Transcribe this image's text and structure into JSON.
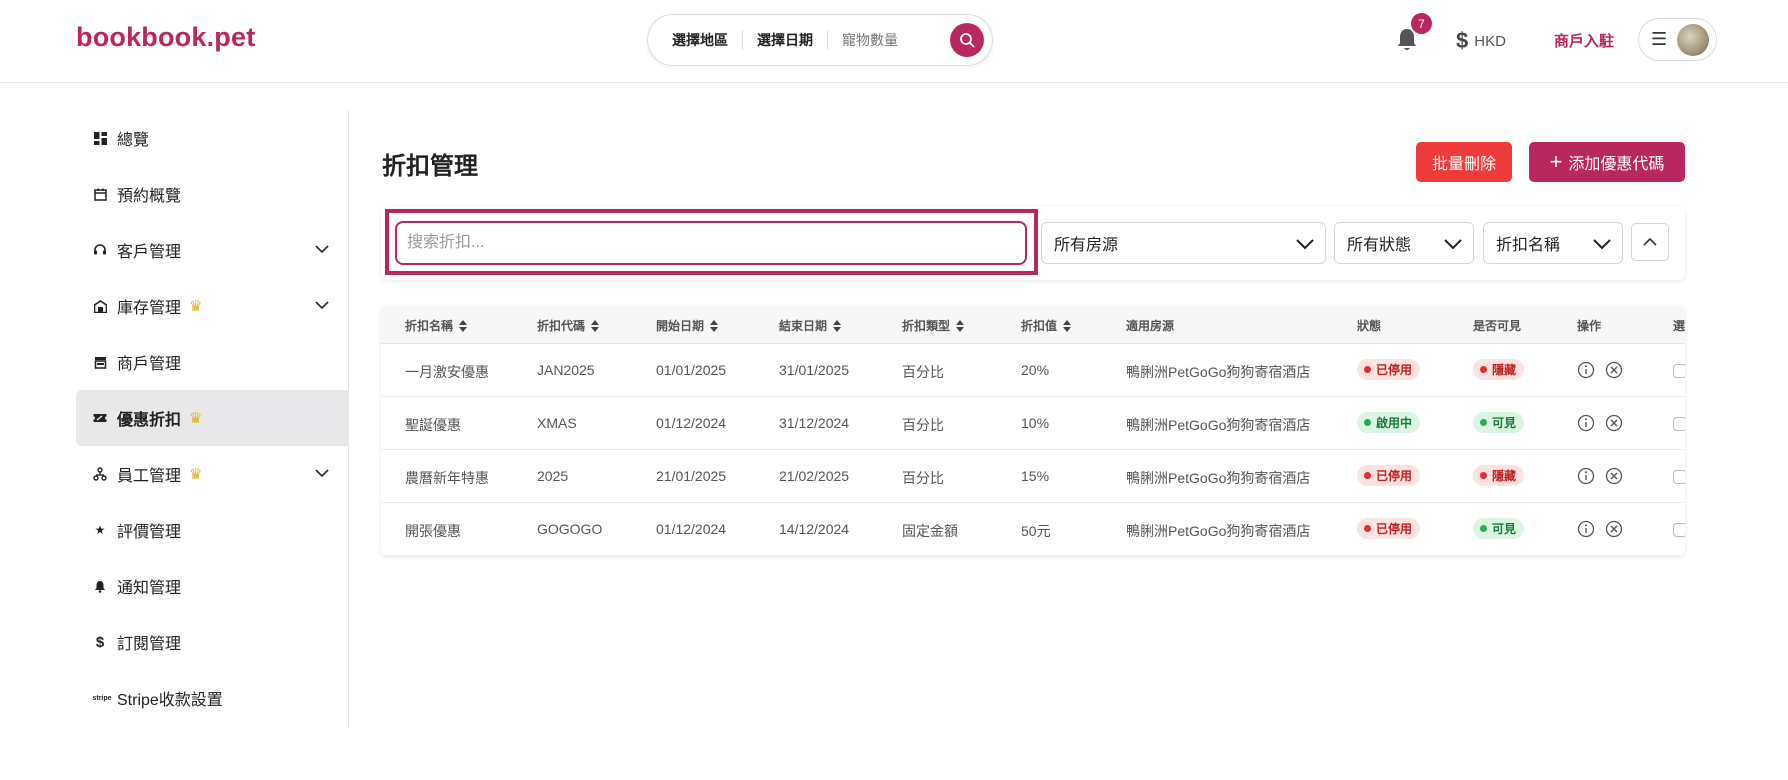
{
  "header": {
    "logo": "bookbook.pet",
    "search": {
      "region": "選擇地區",
      "date": "選擇日期",
      "pets": "寵物數量"
    },
    "notifications_count": "7",
    "currency": "HKD",
    "merchant_link": "商戶入駐"
  },
  "sidebar": {
    "items": [
      {
        "label": "總覽",
        "icon": "dashboard-icon"
      },
      {
        "label": "預約概覽",
        "icon": "calendar-icon"
      },
      {
        "label": "客戶管理",
        "icon": "headset-icon",
        "expandable": true
      },
      {
        "label": "庫存管理",
        "icon": "warehouse-icon",
        "premium": true,
        "expandable": true
      },
      {
        "label": "商戶管理",
        "icon": "store-icon"
      },
      {
        "label": "優惠折扣",
        "icon": "ticket-icon",
        "premium": true,
        "active": true
      },
      {
        "label": "員工管理",
        "icon": "org-chart-icon",
        "premium": true,
        "expandable": true
      },
      {
        "label": "評價管理",
        "icon": "star-icon"
      },
      {
        "label": "通知管理",
        "icon": "bell-icon"
      },
      {
        "label": "訂閱管理",
        "icon": "dollar-icon"
      },
      {
        "label": "Stripe收款設置",
        "icon": "stripe-icon"
      }
    ]
  },
  "main": {
    "title": "折扣管理",
    "bulk_delete": "批量刪除",
    "add_coupon": "添加優惠代碼",
    "filters": {
      "search_placeholder": "搜索折扣...",
      "listing": "所有房源",
      "status": "所有狀態",
      "sort": "折扣名稱"
    },
    "table": {
      "headers": [
        "折扣名稱",
        "折扣代碼",
        "開始日期",
        "結束日期",
        "折扣類型",
        "折扣值",
        "適用房源",
        "狀態",
        "是否可見",
        "操作",
        "選"
      ],
      "rows": [
        {
          "name": "一月激安優惠",
          "code": "JAN2025",
          "start": "01/01/2025",
          "end": "31/01/2025",
          "type": "百分比",
          "value": "20%",
          "listing": "鴨脷洲PetGoGo狗狗寄宿酒店",
          "status": "已停用",
          "status_color": "red",
          "visibility": "隱藏",
          "visibility_color": "red"
        },
        {
          "name": "聖誕優惠",
          "code": "XMAS",
          "start": "01/12/2024",
          "end": "31/12/2024",
          "type": "百分比",
          "value": "10%",
          "listing": "鴨脷洲PetGoGo狗狗寄宿酒店",
          "status": "啟用中",
          "status_color": "green",
          "visibility": "可見",
          "visibility_color": "green"
        },
        {
          "name": "農曆新年特惠",
          "code": "2025",
          "start": "21/01/2025",
          "end": "21/02/2025",
          "type": "百分比",
          "value": "15%",
          "listing": "鴨脷洲PetGoGo狗狗寄宿酒店",
          "status": "已停用",
          "status_color": "red",
          "visibility": "隱藏",
          "visibility_color": "red"
        },
        {
          "name": "開張優惠",
          "code": "GOGOGO",
          "start": "01/12/2024",
          "end": "14/12/2024",
          "type": "固定金額",
          "value": "50元",
          "listing": "鴨脷洲PetGoGo狗狗寄宿酒店",
          "status": "已停用",
          "status_color": "red",
          "visibility": "可見",
          "visibility_color": "green"
        }
      ]
    }
  },
  "colors": {
    "brand": "#b8285e",
    "danger": "#ef3b3b",
    "active_bg": "#e8e8ea",
    "crown": "#e8b500"
  }
}
